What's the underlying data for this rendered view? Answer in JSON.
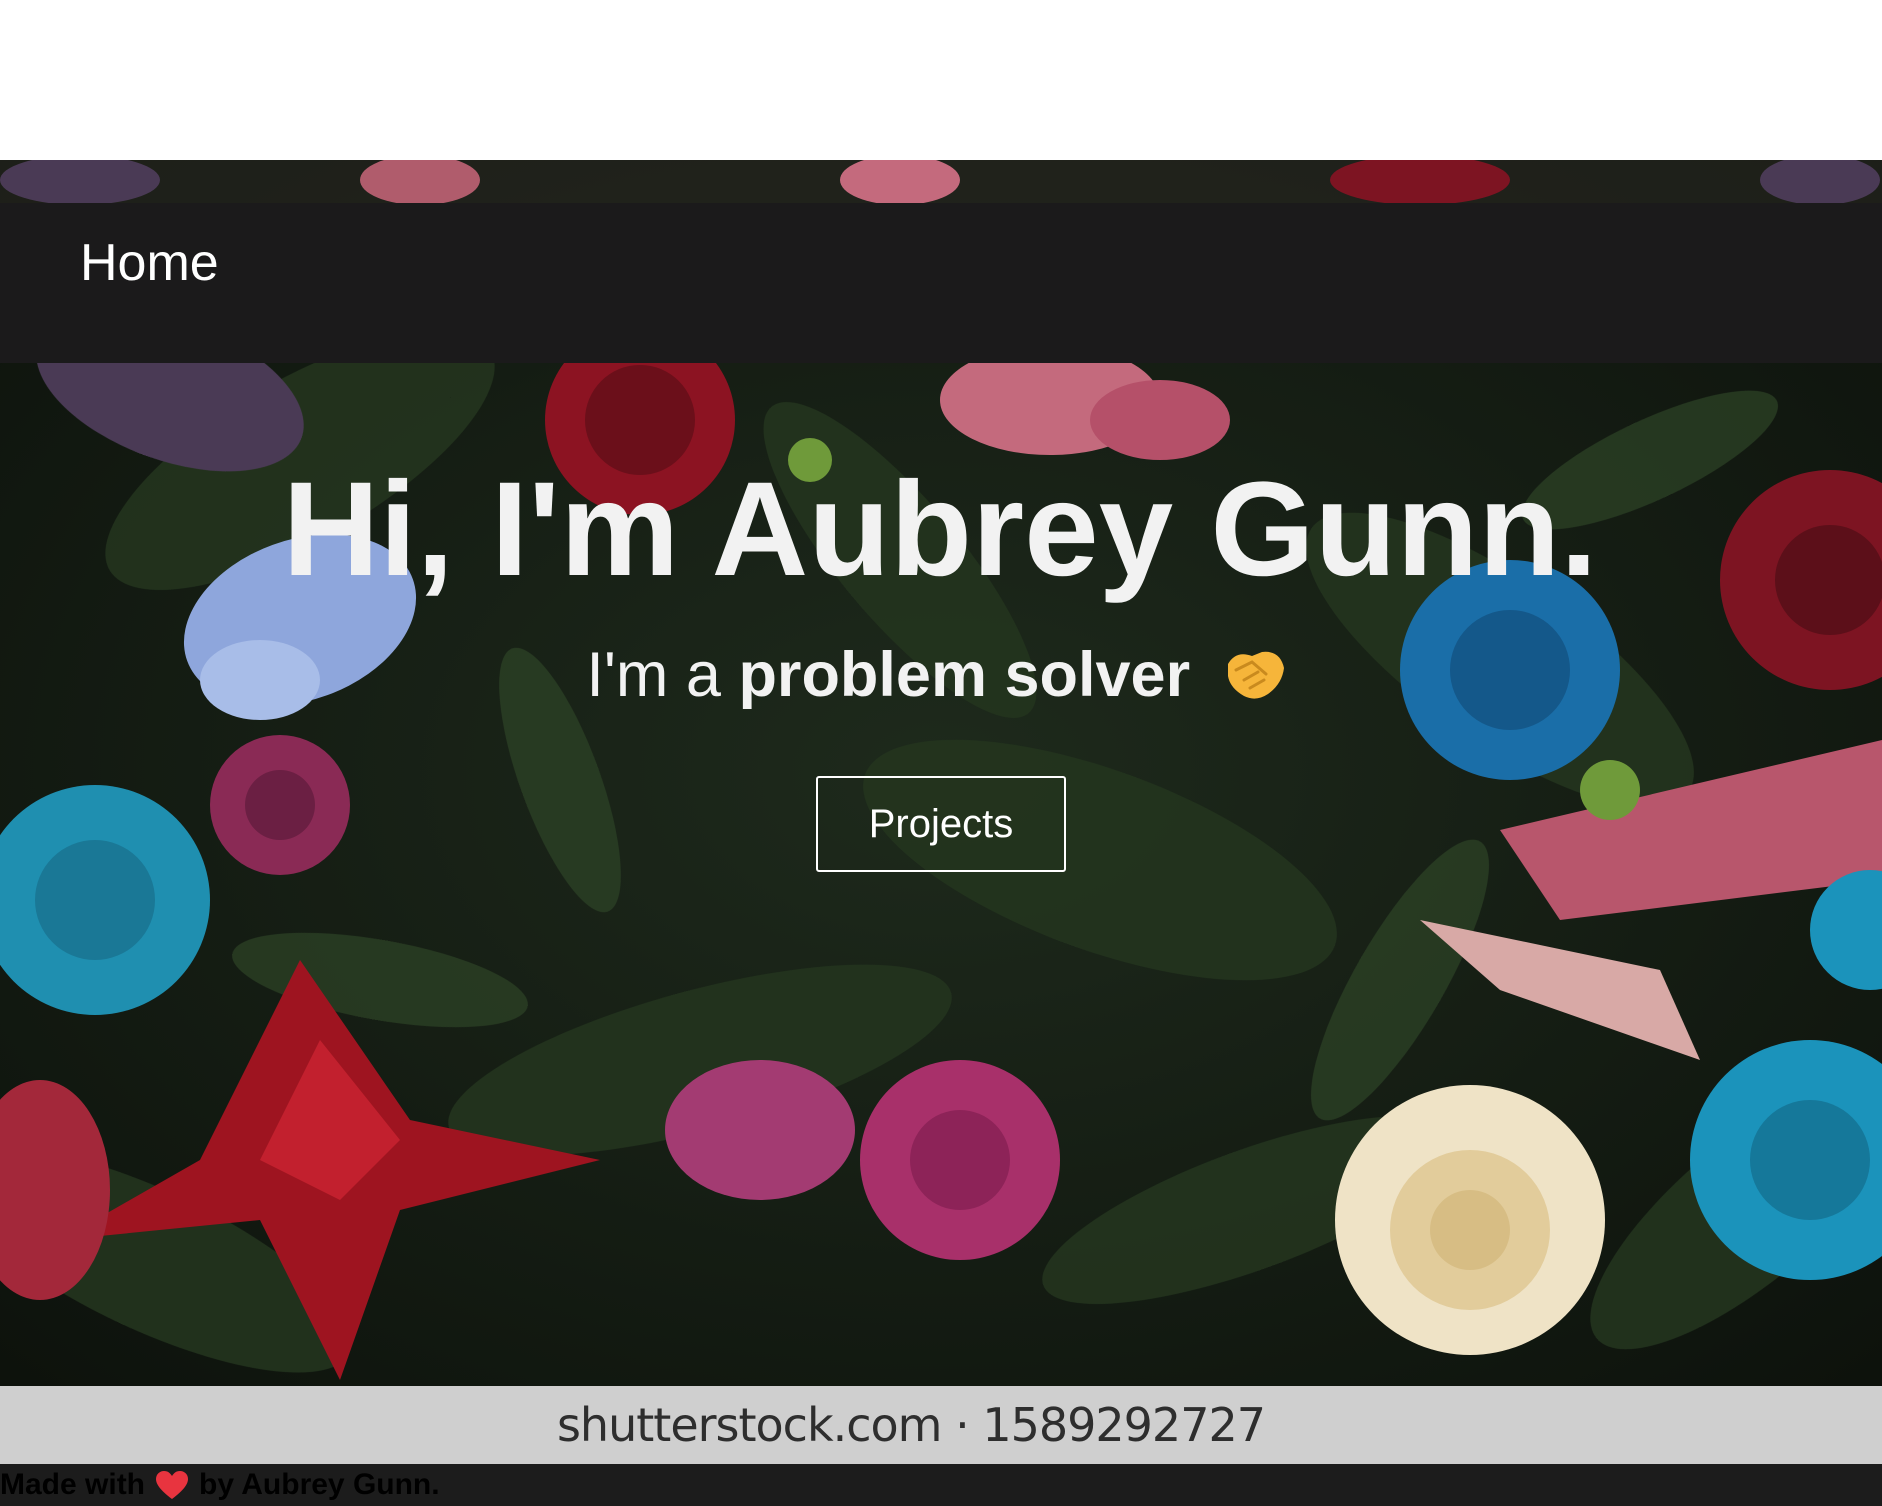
{
  "nav": {
    "home_label": "Home"
  },
  "hero": {
    "title": "Hi, I'm Aubrey Gunn.",
    "subtitle_prefix": "I'm a",
    "subtitle_emphasis": "problem solver",
    "subtitle_icon": "handshake-icon",
    "projects_label": "Projects"
  },
  "watermark": {
    "text": "shutterstock.com · 1589292727"
  },
  "footer": {
    "made_with": "Made with",
    "heart_icon": "heart-icon",
    "by_text": "by Aubrey Gunn."
  },
  "colors": {
    "navbar": "#1b1a1b",
    "text": "#f2f2f2",
    "footer": "#1c1c1c",
    "heart": "#e8343f",
    "handshake": "#f6b53a"
  }
}
